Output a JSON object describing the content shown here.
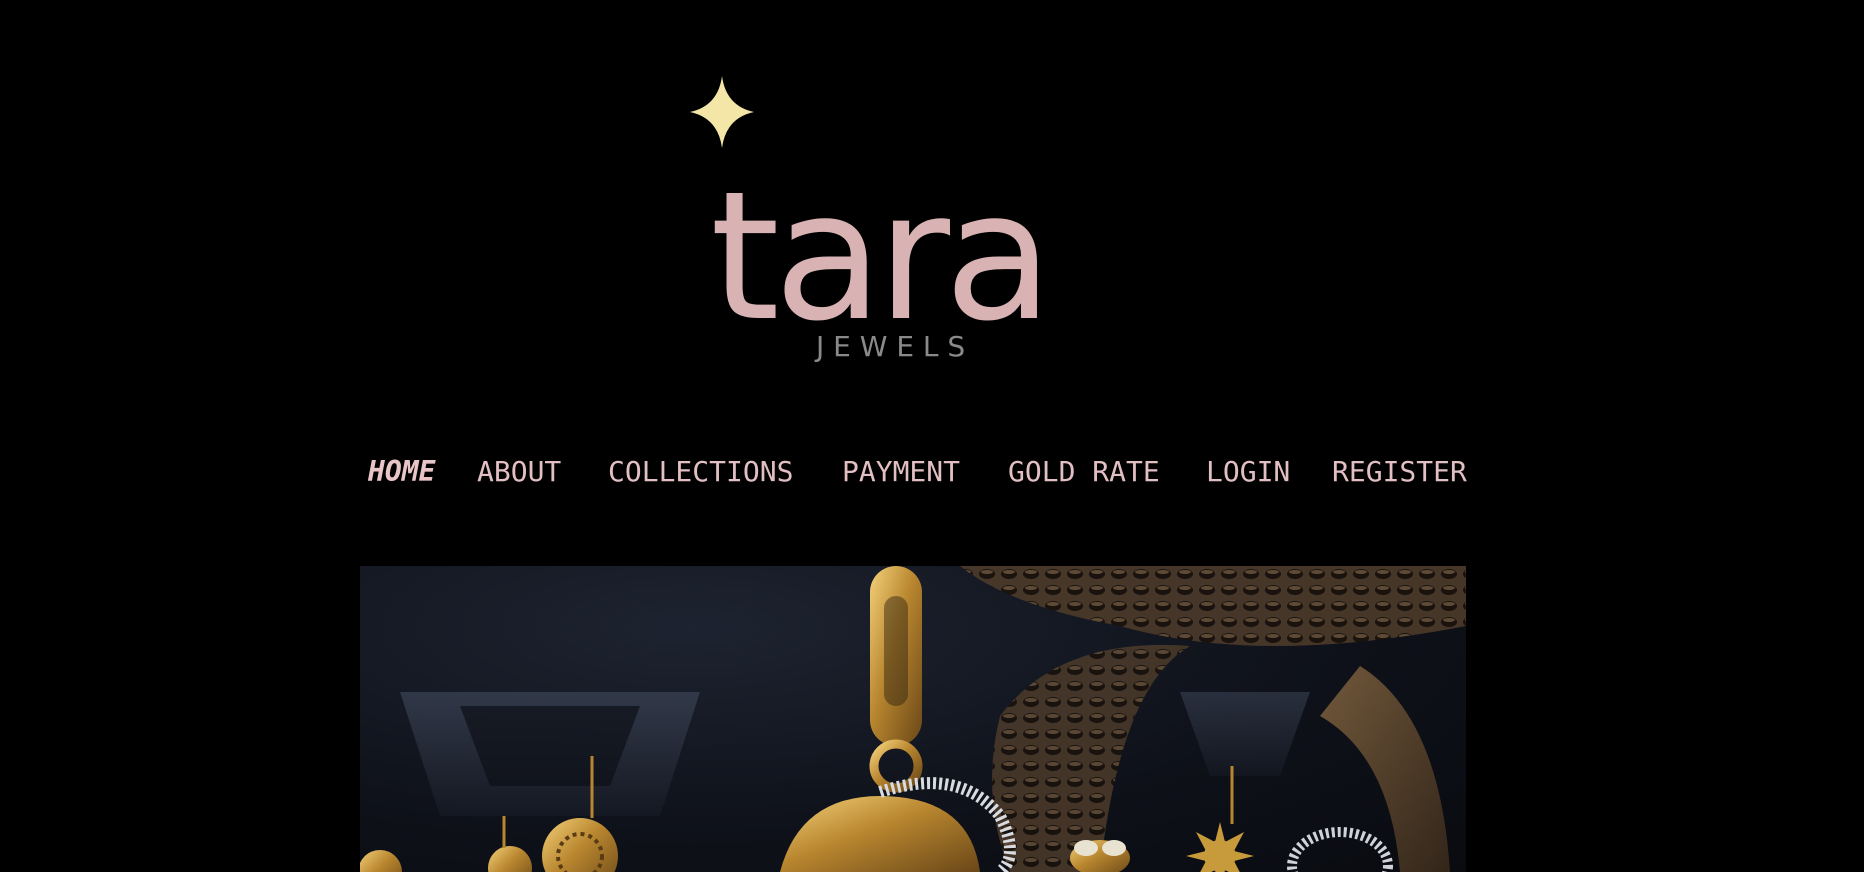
{
  "brand": {
    "name": "tara",
    "tagline": "J E W E L S",
    "star_icon": "four-point-star-icon",
    "star_color": "#f3e6a6",
    "wordmark_color": "#d9b2b4"
  },
  "nav": {
    "items": [
      {
        "label": "HOME",
        "active": true
      },
      {
        "label": "ABOUT"
      },
      {
        "label": "COLLECTIONS"
      },
      {
        "label": "PAYMENT"
      },
      {
        "label": "GOLD RATE"
      },
      {
        "label": "LOGIN"
      },
      {
        "label": "REGISTER"
      }
    ],
    "color": "#e2bfc2"
  },
  "hero": {
    "image": "gold-jewellery-pendants-display"
  }
}
